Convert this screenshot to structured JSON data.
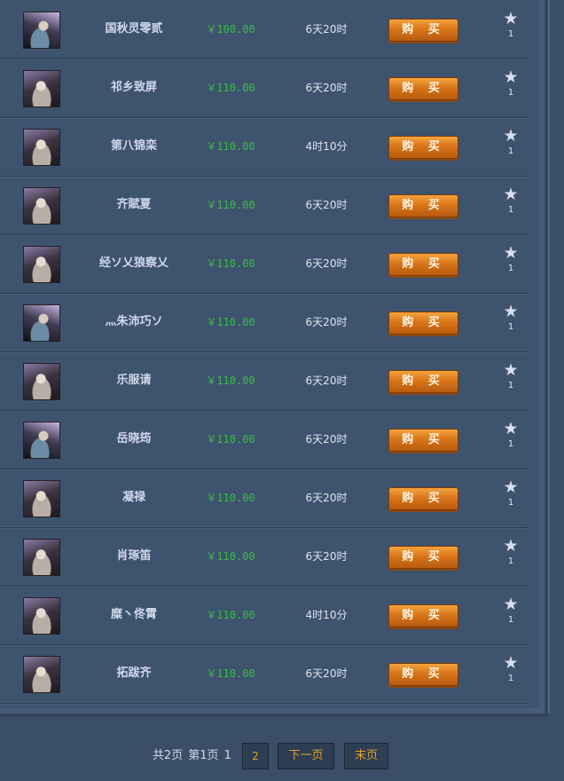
{
  "market": {
    "items": [
      {
        "name": "国秋灵零贰",
        "price": "￥100.00",
        "time": "6天20时",
        "buy_label": "购 买",
        "stars": "1"
      },
      {
        "name": "祁乡致屏",
        "price": "￥110.00",
        "time": "6天20时",
        "buy_label": "购 买",
        "stars": "1"
      },
      {
        "name": "第八锦栾",
        "price": "￥110.00",
        "time": "4时10分",
        "buy_label": "购 买",
        "stars": "1"
      },
      {
        "name": "齐賦夏",
        "price": "￥110.00",
        "time": "6天20时",
        "buy_label": "购 买",
        "stars": "1"
      },
      {
        "name": "经ソ乂狼察乂",
        "price": "￥110.00",
        "time": "6天20时",
        "buy_label": "购 买",
        "stars": "1"
      },
      {
        "name": "灬朱沛巧ソ",
        "price": "￥110.00",
        "time": "6天20时",
        "buy_label": "购 买",
        "stars": "1"
      },
      {
        "name": "乐服请",
        "price": "￥110.00",
        "time": "6天20时",
        "buy_label": "购 买",
        "stars": "1"
      },
      {
        "name": "岳晓筠",
        "price": "￥110.00",
        "time": "6天20时",
        "buy_label": "购 买",
        "stars": "1"
      },
      {
        "name": "凝禄",
        "price": "￥110.00",
        "time": "6天20时",
        "buy_label": "购 买",
        "stars": "1"
      },
      {
        "name": "肖琢笛",
        "price": "￥110.00",
        "time": "6天20时",
        "buy_label": "购 买",
        "stars": "1"
      },
      {
        "name": "糜丶佟霄",
        "price": "￥110.00",
        "time": "4时10分",
        "buy_label": "购 买",
        "stars": "1"
      },
      {
        "name": "拓跋齐",
        "price": "￥110.00",
        "time": "6天20时",
        "buy_label": "购 买",
        "stars": "1"
      }
    ]
  },
  "pagination": {
    "total_pages": "共2页",
    "current_page": "第1页",
    "page_1": "1",
    "page_2": "2",
    "next_label": "下一页",
    "last_label": "末页"
  },
  "icons": {
    "star": "star-icon",
    "avatar": "character-portrait"
  },
  "colors": {
    "price": "#3fb84d",
    "button": "#d9761a",
    "page_link": "#e4a32d"
  }
}
